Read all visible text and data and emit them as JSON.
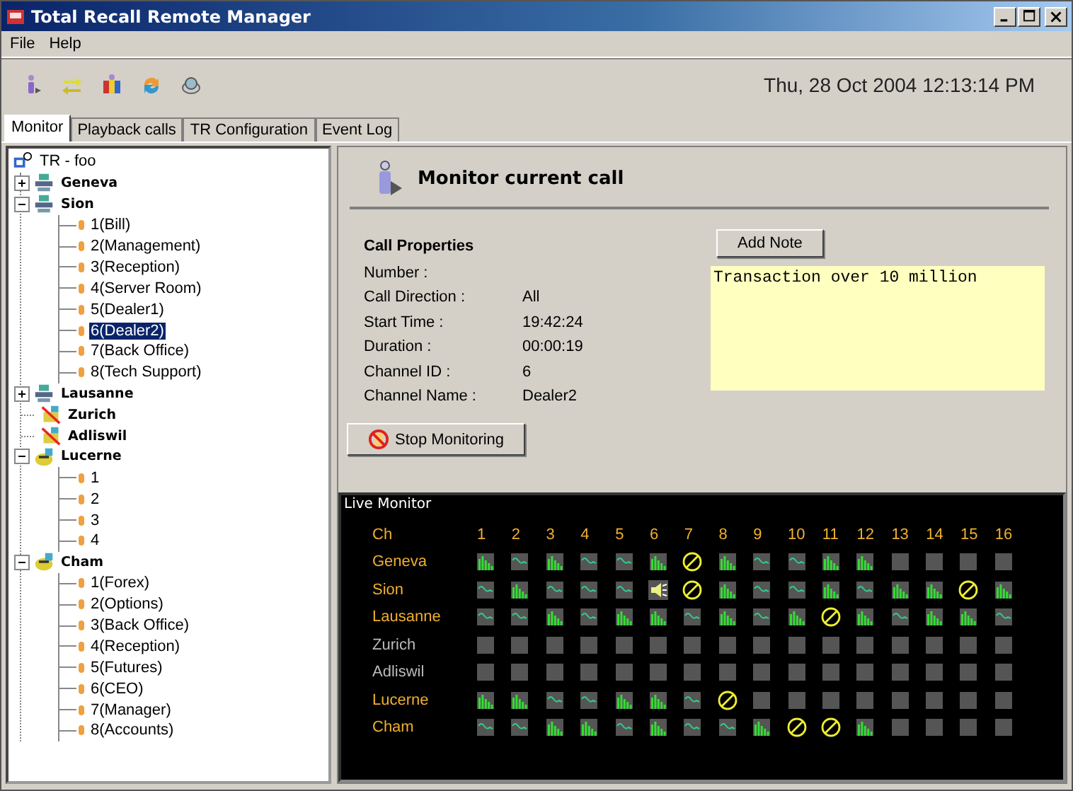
{
  "window": {
    "title": "Total Recall Remote Manager"
  },
  "menu": [
    "File",
    "Help"
  ],
  "clock": "Thu, 28 Oct 2004 12:13:14 PM",
  "tabs": [
    {
      "label": "Monitor",
      "selected": true
    },
    {
      "label": "Playback calls",
      "selected": false
    },
    {
      "label": "TR Configuration",
      "selected": false
    },
    {
      "label": "Event Log",
      "selected": false
    }
  ],
  "tree": {
    "label": "TR - foo",
    "children": [
      {
        "label": "Geneva",
        "kind": "server",
        "expanded": false
      },
      {
        "label": "Sion",
        "kind": "server",
        "expanded": true,
        "children": [
          {
            "label": "1(Bill)",
            "selected": false
          },
          {
            "label": "2(Management)",
            "selected": false
          },
          {
            "label": "3(Reception)",
            "selected": false
          },
          {
            "label": "4(Server Room)",
            "selected": false
          },
          {
            "label": "5(Dealer1)",
            "selected": false
          },
          {
            "label": "6(Dealer2)",
            "selected": true
          },
          {
            "label": "7(Back Office)",
            "selected": false
          },
          {
            "label": "8(Tech Support)",
            "selected": false
          }
        ]
      },
      {
        "label": "Lausanne",
        "kind": "server",
        "expanded": false
      },
      {
        "label": "Zurich",
        "kind": "offline"
      },
      {
        "label": "Adliswil",
        "kind": "offline"
      },
      {
        "label": "Lucerne",
        "kind": "phone",
        "expanded": true,
        "children": [
          {
            "label": "1",
            "selected": false
          },
          {
            "label": "2",
            "selected": false
          },
          {
            "label": "3",
            "selected": false
          },
          {
            "label": "4",
            "selected": false
          }
        ]
      },
      {
        "label": "Cham",
        "kind": "phone",
        "expanded": true,
        "children": [
          {
            "label": "1(Forex)",
            "selected": false
          },
          {
            "label": "2(Options)",
            "selected": false
          },
          {
            "label": "3(Back Office)",
            "selected": false
          },
          {
            "label": "4(Reception)",
            "selected": false
          },
          {
            "label": "5(Futures)",
            "selected": false
          },
          {
            "label": "6(CEO)",
            "selected": false
          },
          {
            "label": "7(Manager)",
            "selected": false
          },
          {
            "label": "8(Accounts)",
            "selected": false
          }
        ]
      }
    ]
  },
  "panel": {
    "title": "Monitor current call",
    "section": "Call Properties",
    "properties": [
      {
        "label": "Number :"
      },
      {
        "label": "Call Direction :",
        "value": "All"
      },
      {
        "label": "Start Time :",
        "value": "19:42:24"
      },
      {
        "label": "Duration :",
        "value": "00:00:19"
      },
      {
        "label": "Channel ID :",
        "value": "6"
      },
      {
        "label": "Channel Name :",
        "value": "Dealer2"
      }
    ],
    "add_note": "Add Note",
    "note": "Transaction over 10 million",
    "stop": "Stop Monitoring"
  },
  "live": {
    "title": "Live Monitor",
    "header": "Ch",
    "columns": [
      "1",
      "2",
      "3",
      "4",
      "5",
      "6",
      "7",
      "8",
      "9",
      "10",
      "11",
      "12",
      "13",
      "14",
      "15",
      "16"
    ],
    "rows": [
      {
        "name": "Geneva",
        "active": true,
        "cells": [
          {
            "kind": "bars"
          },
          {
            "kind": "wave"
          },
          {
            "kind": "bars"
          },
          {
            "kind": "wave"
          },
          {
            "kind": "wave"
          },
          {
            "kind": "bars"
          },
          {
            "kind": "blocked"
          },
          {
            "kind": "bars"
          },
          {
            "kind": "wave"
          },
          {
            "kind": "wave"
          },
          {
            "kind": "bars"
          },
          {
            "kind": "bars"
          },
          {
            "kind": "idle"
          },
          {
            "kind": "idle"
          },
          {
            "kind": "idle"
          },
          {
            "kind": "idle"
          }
        ]
      },
      {
        "name": "Sion",
        "active": true,
        "cells": [
          {
            "kind": "wave"
          },
          {
            "kind": "bars"
          },
          {
            "kind": "wave"
          },
          {
            "kind": "wave"
          },
          {
            "kind": "wave"
          },
          {
            "kind": "speaker"
          },
          {
            "kind": "blocked"
          },
          {
            "kind": "bars"
          },
          {
            "kind": "wave"
          },
          {
            "kind": "wave"
          },
          {
            "kind": "bars"
          },
          {
            "kind": "wave"
          },
          {
            "kind": "bars"
          },
          {
            "kind": "bars"
          },
          {
            "kind": "blocked"
          },
          {
            "kind": "bars"
          }
        ]
      },
      {
        "name": "Lausanne",
        "active": true,
        "cells": [
          {
            "kind": "wave"
          },
          {
            "kind": "wave"
          },
          {
            "kind": "bars"
          },
          {
            "kind": "wave"
          },
          {
            "kind": "bars"
          },
          {
            "kind": "bars"
          },
          {
            "kind": "wave"
          },
          {
            "kind": "bars"
          },
          {
            "kind": "wave"
          },
          {
            "kind": "bars"
          },
          {
            "kind": "blocked"
          },
          {
            "kind": "bars"
          },
          {
            "kind": "wave"
          },
          {
            "kind": "bars"
          },
          {
            "kind": "bars"
          },
          {
            "kind": "wave"
          }
        ]
      },
      {
        "name": "Zurich",
        "active": false,
        "cells": [
          {
            "kind": "idle"
          },
          {
            "kind": "idle"
          },
          {
            "kind": "idle"
          },
          {
            "kind": "idle"
          },
          {
            "kind": "idle"
          },
          {
            "kind": "idle"
          },
          {
            "kind": "idle"
          },
          {
            "kind": "idle"
          },
          {
            "kind": "idle"
          },
          {
            "kind": "idle"
          },
          {
            "kind": "idle"
          },
          {
            "kind": "idle"
          },
          {
            "kind": "idle"
          },
          {
            "kind": "idle"
          },
          {
            "kind": "idle"
          },
          {
            "kind": "idle"
          }
        ]
      },
      {
        "name": "Adliswil",
        "active": false,
        "cells": [
          {
            "kind": "idle"
          },
          {
            "kind": "idle"
          },
          {
            "kind": "idle"
          },
          {
            "kind": "idle"
          },
          {
            "kind": "idle"
          },
          {
            "kind": "idle"
          },
          {
            "kind": "idle"
          },
          {
            "kind": "idle"
          },
          {
            "kind": "idle"
          },
          {
            "kind": "idle"
          },
          {
            "kind": "idle"
          },
          {
            "kind": "idle"
          },
          {
            "kind": "idle"
          },
          {
            "kind": "idle"
          },
          {
            "kind": "idle"
          },
          {
            "kind": "idle"
          }
        ]
      },
      {
        "name": "Lucerne",
        "active": true,
        "cells": [
          {
            "kind": "bars"
          },
          {
            "kind": "bars"
          },
          {
            "kind": "wave"
          },
          {
            "kind": "wave"
          },
          {
            "kind": "bars"
          },
          {
            "kind": "bars"
          },
          {
            "kind": "wave"
          },
          {
            "kind": "blocked"
          },
          {
            "kind": "idle"
          },
          {
            "kind": "idle"
          },
          {
            "kind": "idle"
          },
          {
            "kind": "idle"
          },
          {
            "kind": "idle"
          },
          {
            "kind": "idle"
          },
          {
            "kind": "idle"
          },
          {
            "kind": "idle"
          }
        ]
      },
      {
        "name": "Cham",
        "active": true,
        "cells": [
          {
            "kind": "wave"
          },
          {
            "kind": "wave"
          },
          {
            "kind": "bars"
          },
          {
            "kind": "bars"
          },
          {
            "kind": "wave"
          },
          {
            "kind": "bars"
          },
          {
            "kind": "wave"
          },
          {
            "kind": "wave"
          },
          {
            "kind": "bars"
          },
          {
            "kind": "blocked"
          },
          {
            "kind": "blocked"
          },
          {
            "kind": "bars"
          },
          {
            "kind": "idle"
          },
          {
            "kind": "idle"
          },
          {
            "kind": "idle"
          },
          {
            "kind": "idle"
          }
        ]
      }
    ]
  }
}
